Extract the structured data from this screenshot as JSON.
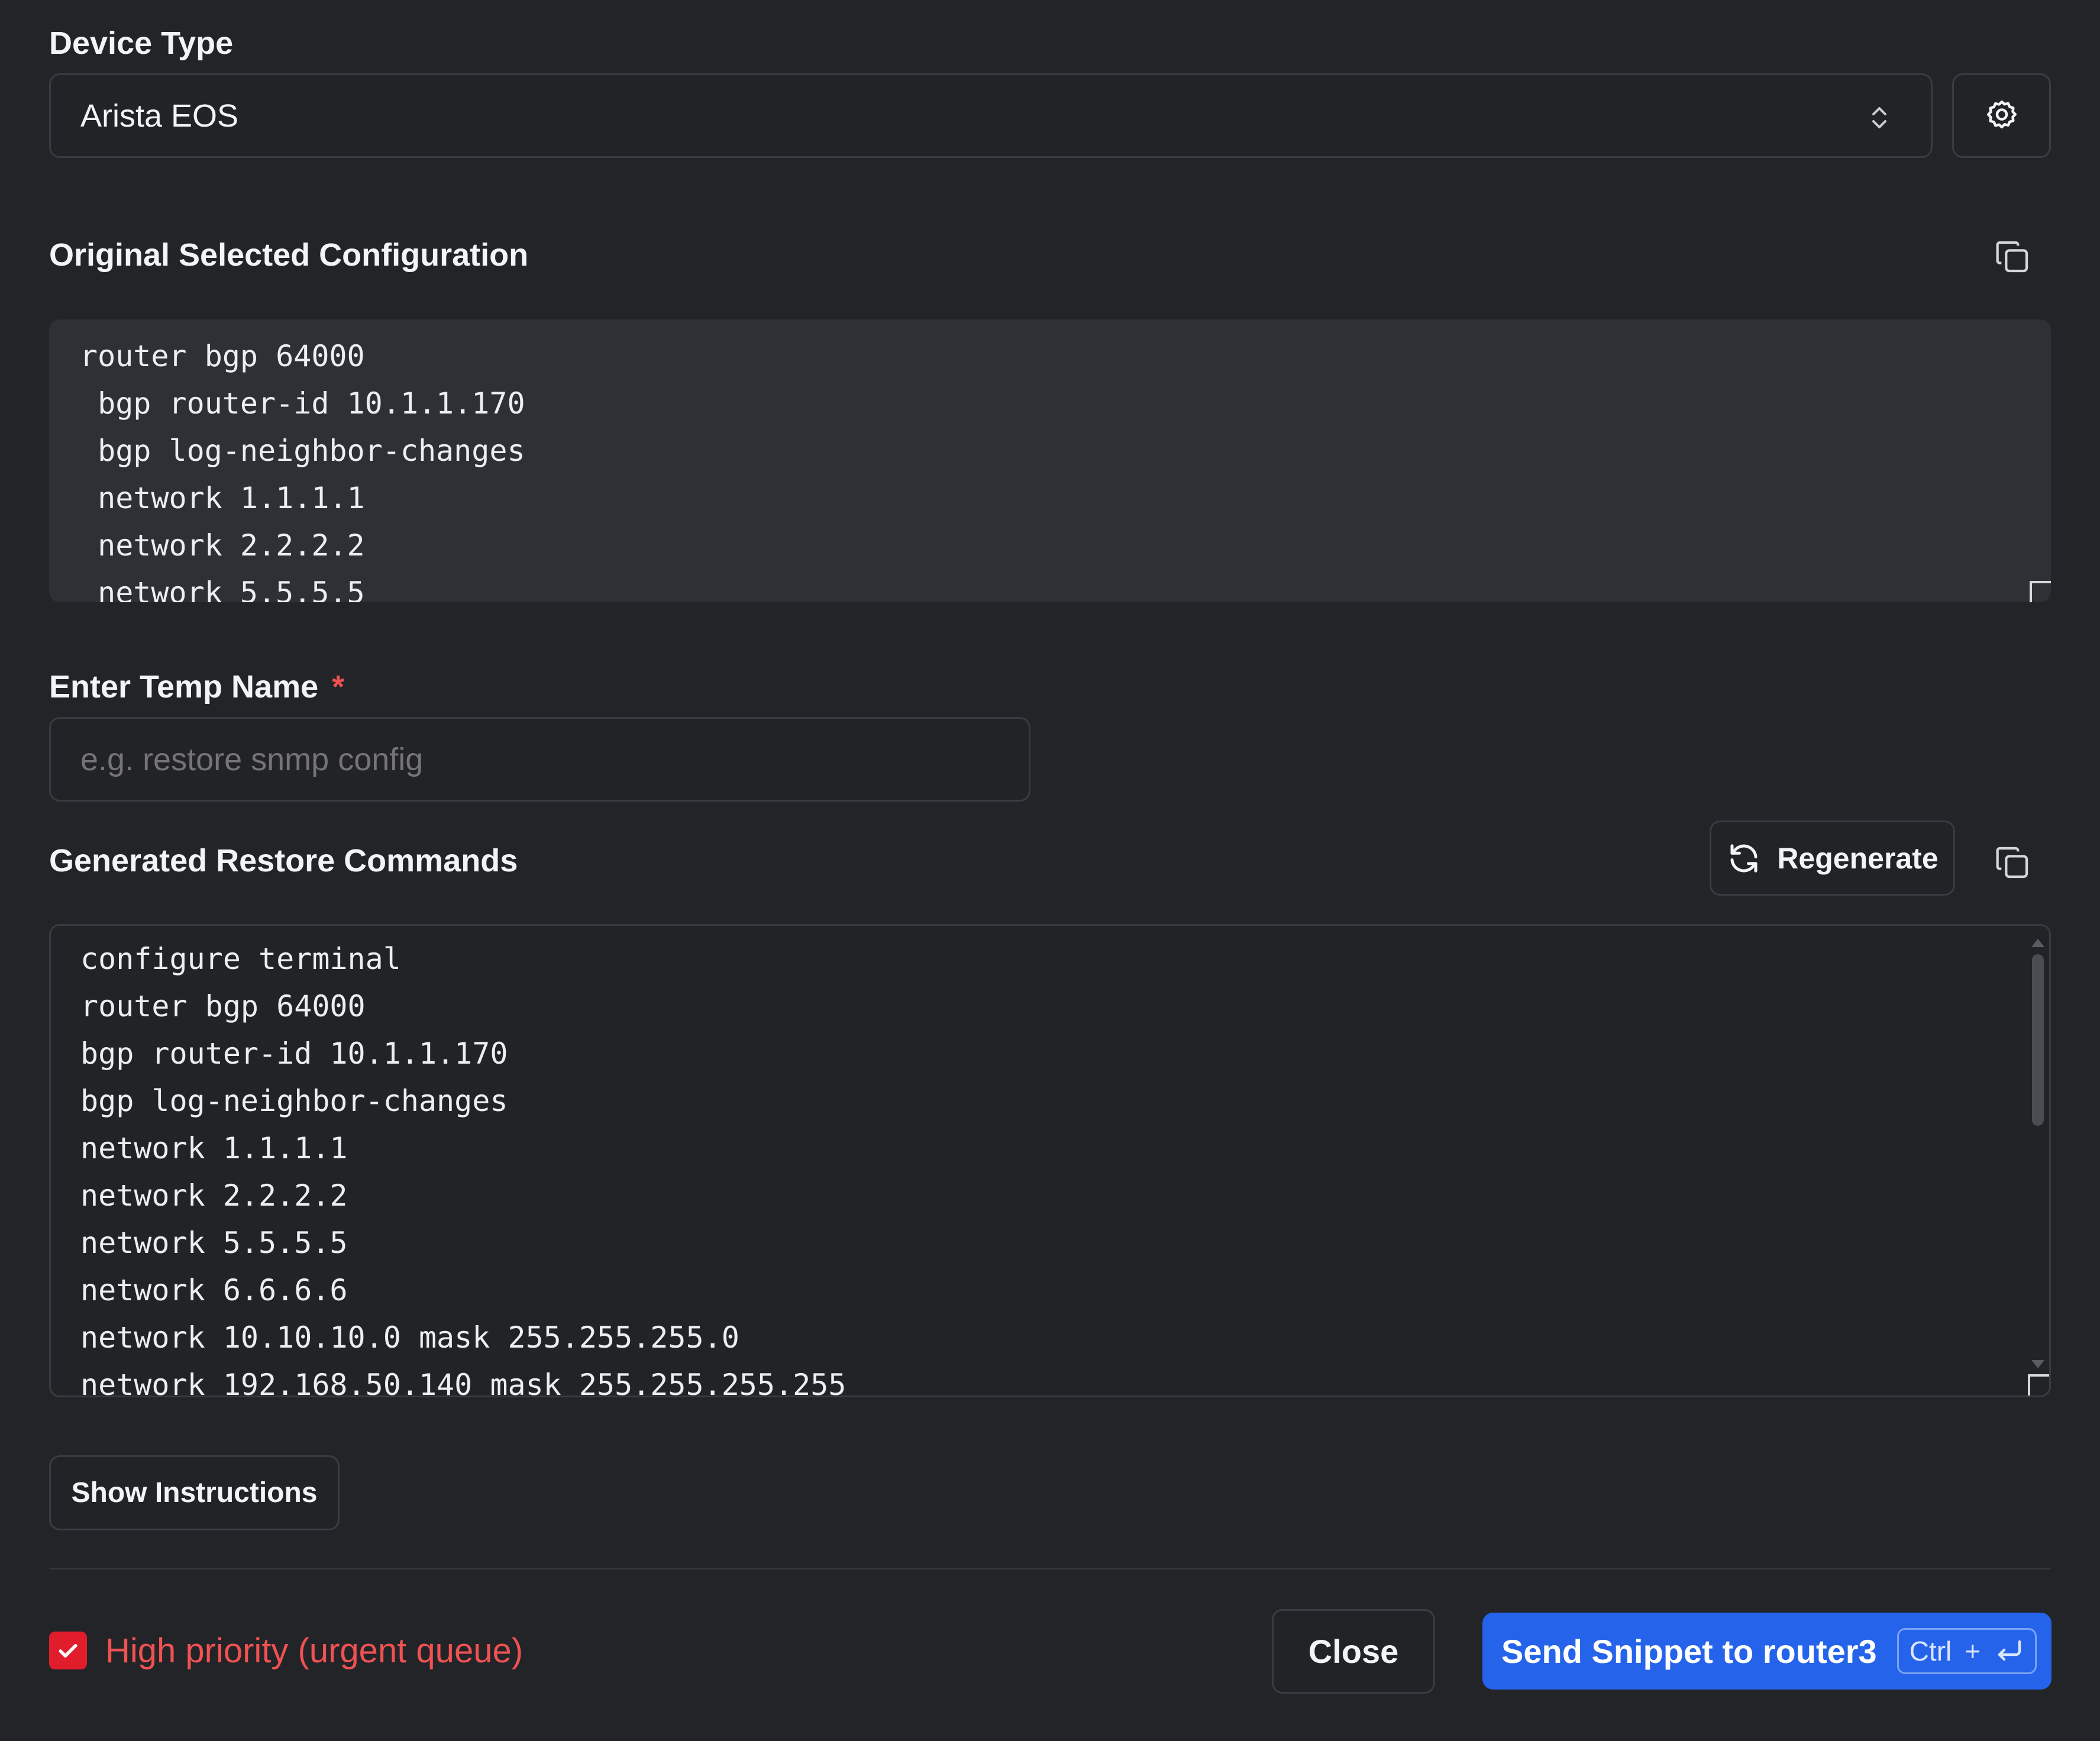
{
  "device_type": {
    "label": "Device Type",
    "selected": "Arista EOS",
    "chevron_icon": "chevron-up-down-icon",
    "settings_icon": "gear-icon"
  },
  "original_config": {
    "title": "Original Selected Configuration",
    "copy_icon": "copy-icon",
    "lines": [
      "router bgp 64000",
      " bgp router-id 10.1.1.170",
      " bgp log-neighbor-changes",
      " network 1.1.1.1",
      " network 2.2.2.2",
      " network 5.5.5.5"
    ]
  },
  "temp_name": {
    "label": "Enter Temp Name",
    "required_marker": "*",
    "placeholder": "e.g. restore snmp config",
    "value": ""
  },
  "generated": {
    "title": "Generated Restore Commands",
    "regenerate_label": "Regenerate",
    "regenerate_icon": "refresh-icon",
    "copy_icon": "copy-icon",
    "lines": [
      "configure terminal",
      "router bgp 64000",
      "bgp router-id 10.1.1.170",
      "bgp log-neighbor-changes",
      "network 1.1.1.1",
      "network 2.2.2.2",
      "network 5.5.5.5",
      "network 6.6.6.6",
      "network 10.10.10.0 mask 255.255.255.0",
      "network 192.168.50.140 mask 255.255.255.255"
    ]
  },
  "show_instructions_label": "Show Instructions",
  "footer": {
    "priority_checked": true,
    "priority_label": "High priority (urgent queue)",
    "close_label": "Close",
    "send_label": "Send Snippet to router3",
    "shortcut_ctrl": "Ctrl",
    "shortcut_plus": "+",
    "shortcut_enter_icon": "enter-key-icon"
  },
  "colors": {
    "background": "#232428",
    "accent": "#2563eb",
    "danger": "#f05252",
    "checkbox": "#e11d2b"
  }
}
